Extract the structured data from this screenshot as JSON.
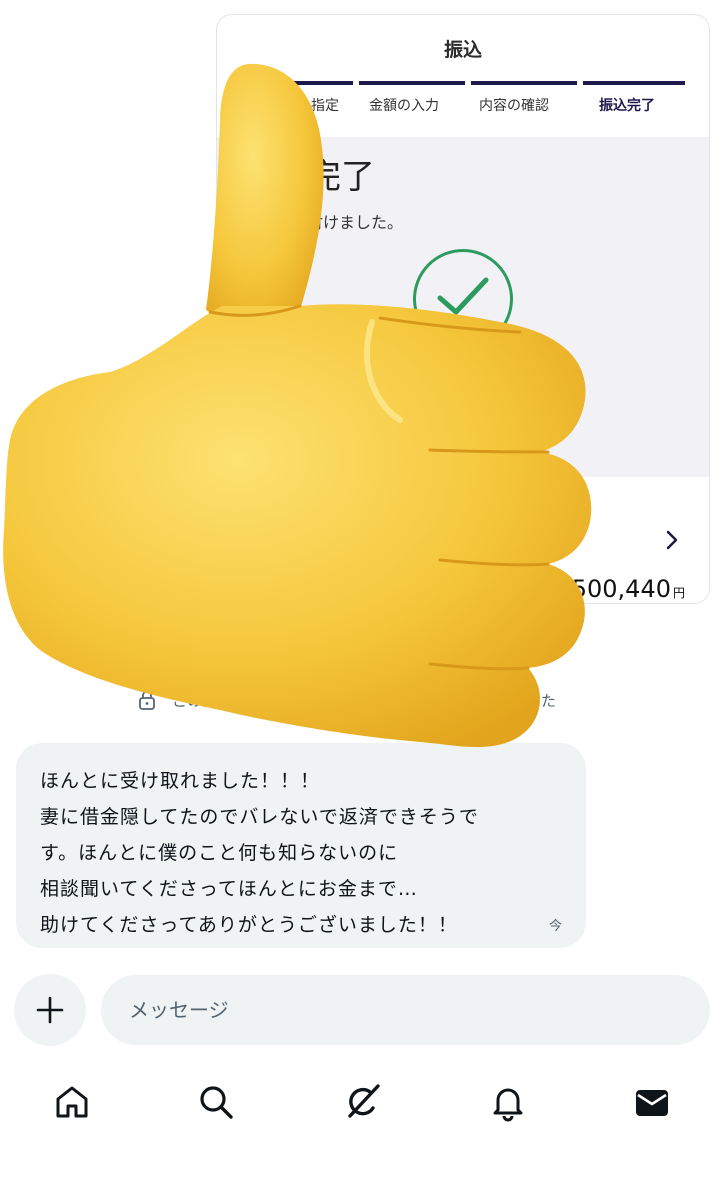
{
  "transfer_card": {
    "title": "振込",
    "steps": [
      "の指定",
      "金額の入力",
      "内容の確認",
      "振込完了"
    ],
    "done_title": "完了",
    "done_subtitle": "付けました。",
    "amount": "500,440",
    "currency": "円"
  },
  "notice": {
    "text_left": "この会話",
    "text_right": "れました"
  },
  "message": {
    "lines": [
      "ほんとに受け取れました！！！",
      "妻に借金隠してたのでバレないで返済できそうで",
      "す。ほんとに僕のこと何も知らないのに",
      "相談聞いてくださってほんとにお金まで…",
      "助けてくださってありがとうございました！！"
    ],
    "timestamp": "今"
  },
  "composer": {
    "placeholder": "メッセージ"
  },
  "nav": {
    "items": [
      "home-icon",
      "search-icon",
      "grok-icon",
      "bell-icon",
      "mail-icon"
    ]
  },
  "colors": {
    "accent": "#1f1a4d",
    "success": "#2d9a5f",
    "bubble": "#eff3f4",
    "emoji_yellow": "#f7c93b"
  }
}
